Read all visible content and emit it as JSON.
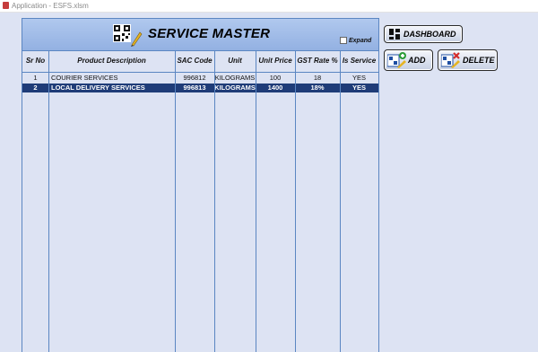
{
  "window": {
    "title": "Application - ESFS.xlsm"
  },
  "header": {
    "title": "SERVICE MASTER",
    "expand_label": "Expand"
  },
  "buttons": {
    "dashboard": "DASHBOARD",
    "add": "ADD",
    "delete": "DELETE"
  },
  "table": {
    "columns": [
      "Sr No",
      "Product Description",
      "SAC Code",
      "Unit",
      "Unit Price",
      "GST Rate %",
      "Is Service"
    ],
    "rows": [
      [
        "1",
        "COURIER SERVICES",
        "996812",
        "KILOGRAMS",
        "100",
        "18",
        "YES"
      ],
      [
        "2",
        "LOCAL DELIVERY SERVICES",
        "996813",
        "KILOGRAMS",
        "1400",
        "18%",
        "YES"
      ]
    ],
    "selected_row": 2
  },
  "colors": {
    "background": "#dde3f3",
    "header_band": "#a3bde8",
    "grid_line": "#5b86c2",
    "selected_row": "#1f3c78"
  }
}
